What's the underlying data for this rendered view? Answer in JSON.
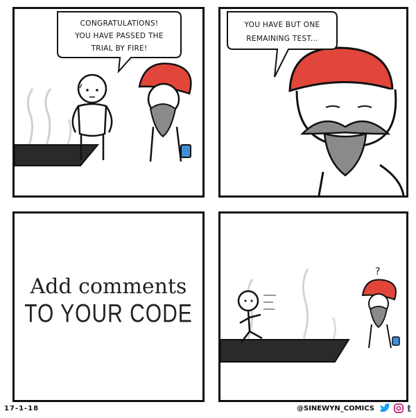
{
  "panels": {
    "panel1": {
      "speech": [
        "CONGRATULATIONS!",
        "YOU HAVE PASSED THE",
        "TRIAL BY FIRE!"
      ]
    },
    "panel2": {
      "speech": [
        "YOU HAVE BUT ONE",
        "REMAINING TEST..."
      ]
    },
    "panel3": {
      "sign_line1": "Add comments",
      "sign_line2": "TO YOUR CODE"
    },
    "panel4": {
      "question_mark": "?"
    }
  },
  "footer": {
    "date": "17-1-18",
    "handle": "@SINEWYN_COMICS",
    "social_icons": [
      "twitter-icon",
      "instagram-icon",
      "tumblr-icon"
    ]
  },
  "colors": {
    "turban": "#e2463a",
    "beard": "#8a8a8a",
    "coals": "#2a2a2a",
    "bucket": "#3f8fd6",
    "twitter": "#1da1f2",
    "instagram": "#c13584",
    "tumblr": "#35465c"
  }
}
